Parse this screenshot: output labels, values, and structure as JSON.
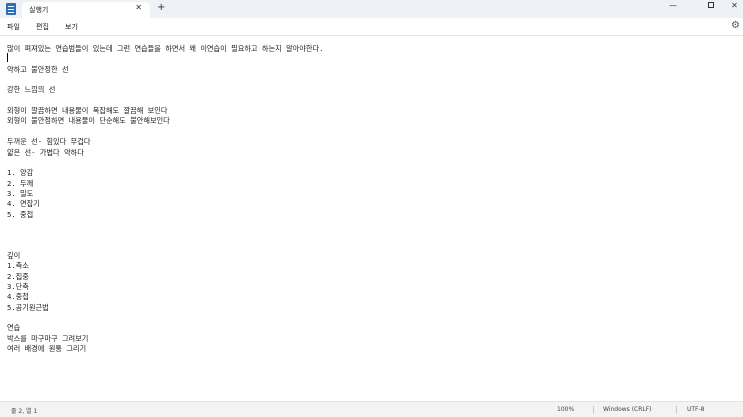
{
  "titlebar": {
    "tab_title": "실행기",
    "close_glyph": "✕",
    "new_tab_glyph": "+",
    "minimize_glyph": "—",
    "close_window_glyph": "✕"
  },
  "menu": {
    "file": "파일",
    "edit": "편집",
    "view": "보기"
  },
  "icons": {
    "settings": "gear-icon",
    "app": "notepad-icon"
  },
  "editor": {
    "lines": [
      "많이 펴져있는 연습범들이 있는데 그런 연습들을 하면서 왜 이연습이 필요하고 하는지 알아야한다.",
      "",
      "약하고 불안정한 선",
      "",
      "강한 느낌의 선",
      "",
      "외형이 깔끔하면 내용물이 복잡해도 깔끔해 보인다",
      "외형이 불안정하면 내용물이 단순해도 불안해보인다",
      "",
      "두꺼운 선- 힘있다 무겁다",
      "얇은 선- 가볍다 약하다",
      "",
      "1. 양감",
      "2. 두께",
      "3. 밀도",
      "4. 면잡기",
      "5. 중첩",
      "",
      "",
      "",
      "깊이",
      "1.축소",
      "2.집중",
      "3.단축",
      "4.중첩",
      "5.공기원근법",
      "",
      "연습",
      "박스를 마구마구 그려보기",
      "여러 배경에 원통 그리기"
    ]
  },
  "status": {
    "position": "줄 2, 열 1",
    "zoom": "100%",
    "line_ending": "Windows (CRLF)",
    "encoding": "UTF-8"
  }
}
